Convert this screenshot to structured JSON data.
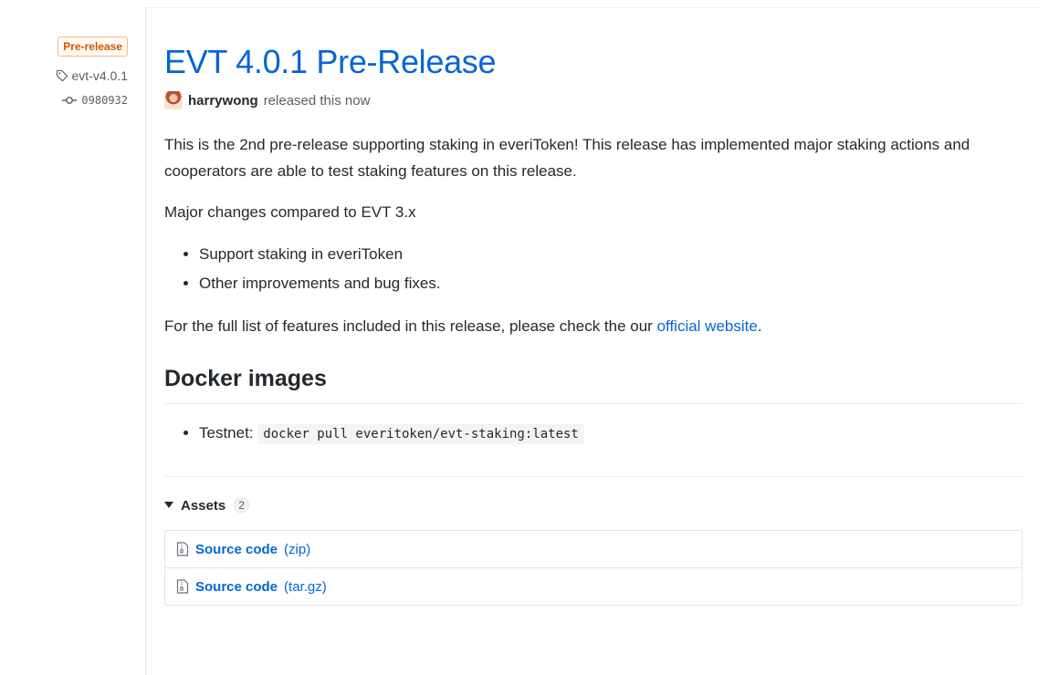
{
  "sidebar": {
    "badge": "Pre-release",
    "tag": "evt-v4.0.1",
    "commit": "0980932"
  },
  "release": {
    "title": "EVT 4.0.1 Pre-Release",
    "author": "harrywong",
    "released_text": "released this now"
  },
  "body": {
    "intro": "This is the 2nd pre-release supporting staking in everiToken! This release has implemented major staking actions and cooperators are able to test staking features on this release.",
    "changes_heading": "Major changes compared to EVT 3.x",
    "changes": [
      "Support staking in everiToken",
      "Other improvements and bug fixes."
    ],
    "full_list_prefix": "For the full list of features included in this release, please check the our ",
    "full_list_link": "official website",
    "full_list_suffix": ".",
    "docker_heading": "Docker images",
    "docker_item_label": "Testnet:",
    "docker_item_code": "docker pull everitoken/evt-staking:latest"
  },
  "assets": {
    "label": "Assets",
    "count": "2",
    "items": [
      {
        "name": "Source code",
        "format": "(zip)"
      },
      {
        "name": "Source code",
        "format": "(tar.gz)"
      }
    ]
  },
  "colors": {
    "link": "#0366d6",
    "badge": "#d15704",
    "text": "#24292e",
    "muted": "#586069"
  },
  "icons": {
    "tag": "tag-icon",
    "commit": "git-commit-icon",
    "triangle": "triangle-down-icon",
    "file": "file-zip-icon"
  }
}
